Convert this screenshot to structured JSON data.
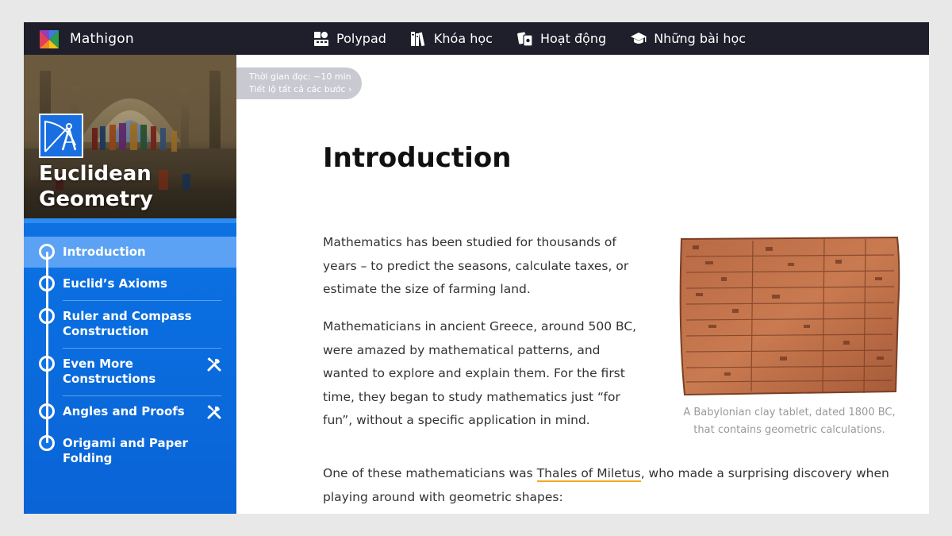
{
  "app": {
    "name": "Mathigon"
  },
  "nav": {
    "items": [
      {
        "label": "Polypad",
        "icon": "polypad-icon"
      },
      {
        "label": "Khóa học",
        "icon": "books-icon"
      },
      {
        "label": "Hoạt động",
        "icon": "cards-icon"
      },
      {
        "label": "Những bài học",
        "icon": "graduation-cap-icon"
      }
    ]
  },
  "course": {
    "title_line1": "Euclidean",
    "title_line2": "Geometry",
    "icon": "compass-icon"
  },
  "toc": {
    "items": [
      {
        "label": "Introduction",
        "active": true,
        "tool": false
      },
      {
        "label": "Euclid’s Axioms",
        "active": false,
        "tool": false
      },
      {
        "label_line1": "Ruler and Compass",
        "label_line2": "Construction",
        "active": false,
        "tool": false
      },
      {
        "label_line1": "Even More",
        "label_line2": "Constructions",
        "active": false,
        "tool": true
      },
      {
        "label": "Angles and Proofs",
        "active": false,
        "tool": true
      },
      {
        "label": "Origami and Paper Folding",
        "active": false,
        "tool": false
      }
    ]
  },
  "reading": {
    "time": "Thời gian đọc: ~10 min",
    "reveal": "Tiết lộ tất cả các bước"
  },
  "content": {
    "title": "Introduction",
    "p1": "Mathematics has been studied for thousands of years – to predict the seasons, calculate taxes, or estimate the size of farming land.",
    "p2": "Mathematicians in ancient Greece, around 500 BC, were amazed by mathematical patterns, and wanted to explore and explain them. For the first time, they began to study mathematics just “for fun”, without a specific application in mind.",
    "p3_before": "One of these mathematicians was ",
    "p3_link": "Thales of Miletus",
    "p3_after": ", who made a surprising discovery when playing around with geometric shapes:",
    "figure_caption": "A Babylonian clay tablet, dated 1800 BC, that contains geometric calculations."
  },
  "colors": {
    "sidebar": "#1172e6",
    "active_item": "#5ba2f5",
    "topbar": "#1f1e2b",
    "link_underline": "#f5a623"
  }
}
